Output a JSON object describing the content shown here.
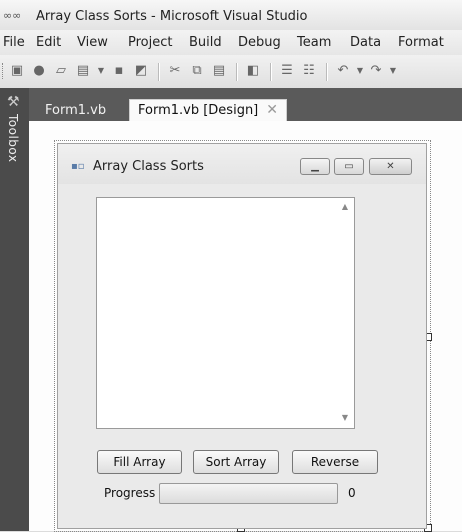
{
  "window": {
    "title": "Array Class Sorts - Microsoft Visual Studio",
    "icon": "infinity-logo-icon"
  },
  "menu": {
    "items": [
      "File",
      "Edit",
      "View",
      "Project",
      "Build",
      "Debug",
      "Team",
      "Data",
      "Format"
    ]
  },
  "toolbar": {
    "icons": [
      "new-project-icon",
      "add-item-icon",
      "open-folder-icon",
      "add-new-item-icon",
      "save-icon",
      "save-all-icon",
      "cut-icon",
      "copy-icon",
      "paste-icon",
      "find-icon",
      "comment-icon",
      "uncomment-icon",
      "undo-icon",
      "redo-icon"
    ]
  },
  "toolbox": {
    "label": "Toolbox"
  },
  "tabs": [
    {
      "label": "Form1.vb"
    },
    {
      "label": "Form1.vb [Design]",
      "close": "✕"
    }
  ],
  "form": {
    "title": "Array Class Sorts",
    "buttons": {
      "fill": "Fill Array",
      "sort": "Sort Array",
      "reverse": "Reverse"
    },
    "progress": {
      "label": "Progress",
      "value": "0",
      "fraction": 0
    }
  }
}
